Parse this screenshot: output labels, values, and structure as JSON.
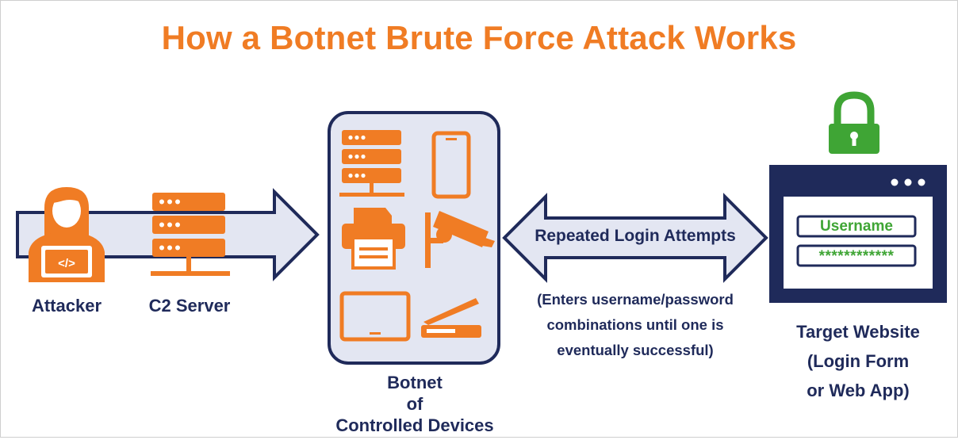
{
  "title": "How a Botnet Brute Force Attack Works",
  "attacker": {
    "label": "Attacker"
  },
  "c2": {
    "label": "C2 Server"
  },
  "botnet": {
    "label_line1": "Botnet",
    "label_line2": "of",
    "label_line3": "Controlled Devices"
  },
  "arrow": {
    "label": "Repeated Login Attempts"
  },
  "note": {
    "line1": "(Enters username/password",
    "line2": "combinations until one is",
    "line3": "eventually successful)"
  },
  "target": {
    "label_line1": "Target Website",
    "label_line2": "(Login Form",
    "label_line3": "or Web App)",
    "username_field": "Username",
    "password_field": "************"
  },
  "colors": {
    "orange": "#f07c24",
    "navy": "#1f2a5a",
    "pale": "#e3e6f2",
    "green": "#3fa535"
  }
}
